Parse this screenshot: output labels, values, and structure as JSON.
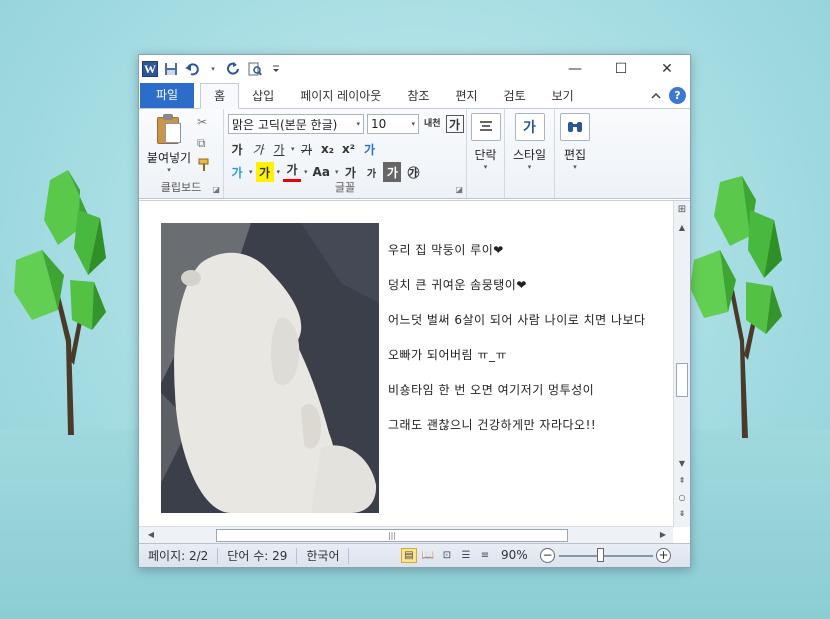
{
  "window": {
    "quick_access": {
      "app_icon": "W",
      "undo_arrow": "▾"
    },
    "controls": {
      "minimize": "—",
      "maximize": "☐",
      "close": "✕"
    }
  },
  "tabs": [
    {
      "label": "파일"
    },
    {
      "label": "홈"
    },
    {
      "label": "삽입"
    },
    {
      "label": "페이지 레이아웃"
    },
    {
      "label": "참조"
    },
    {
      "label": "편지"
    },
    {
      "label": "검토"
    },
    {
      "label": "보기"
    }
  ],
  "ribbon": {
    "clipboard": {
      "paste_label": "붙여넣기",
      "group_label": "클립보드"
    },
    "font": {
      "font_name": "맑은 고딕(본문 한글)",
      "font_size": "10",
      "group_label": "글꼴",
      "grow": "가",
      "italic": "가",
      "underline": "가",
      "strike": "가",
      "subscript": "x₂",
      "superscript": "x²",
      "clear": "가",
      "highlight": "가",
      "color": "가",
      "case": "Aa",
      "ruby": "가",
      "shrink": "가",
      "charbox": "가",
      "circle": "㉮",
      "phonetic": "내천",
      "border_char": "가"
    },
    "paragraph": {
      "label": "단락"
    },
    "styles": {
      "label": "스타일",
      "icon_text": "가"
    },
    "editing": {
      "label": "편집"
    }
  },
  "document": {
    "lines": [
      "우리 집 막둥이 루이❤",
      "덩치 큰 귀여운 솜뭉탱이❤",
      "어느덧 벌써 6살이 되어 사람 나이로 치면 나보다",
      "오빠가 되어버림 ㅠ_ㅠ",
      "비숑타임 한 번 오면 여기저기 멍투성이",
      "그래도 괜찮으니 건강하게만 자라다오!!"
    ]
  },
  "statusbar": {
    "page": "페이지: 2/2",
    "words": "단어 수: 29",
    "language": "한국어",
    "zoom": "90%",
    "zoom_minus": "−",
    "zoom_plus": "+"
  }
}
